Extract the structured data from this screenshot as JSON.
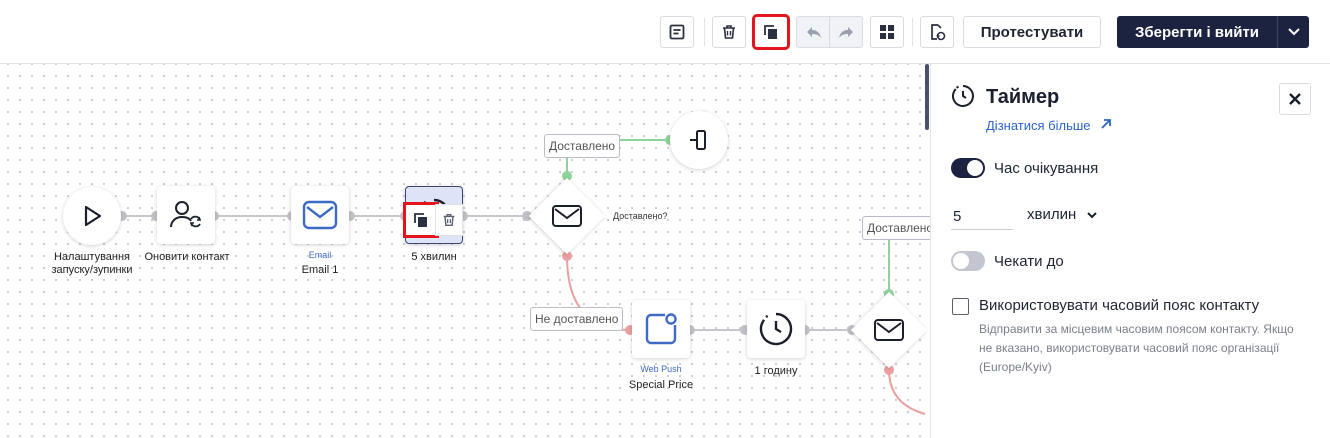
{
  "toolbar": {
    "notes_icon": "notes-icon",
    "delete_icon": "trash-icon",
    "copy_icon": "copy-icon",
    "undo_icon": "undo-icon",
    "redo_icon": "redo-icon",
    "layout_icon": "grid-icon",
    "history_icon": "document-restore-icon",
    "test_label": "Протестувати",
    "save_label": "Зберегти і вийти"
  },
  "canvas": {
    "nodes": {
      "start": {
        "caption_line1": "Налаштування",
        "caption_line2": "запуску/зупинки"
      },
      "update_contact": {
        "caption": "Оновити контакт"
      },
      "email": {
        "channel": "Email",
        "name": "Email 1"
      },
      "timer1": {
        "caption": "5 хвилин"
      },
      "check1": {
        "label": "Доставлено?"
      },
      "webpush": {
        "channel": "Web Push",
        "name": "Special Price"
      },
      "timer2": {
        "caption": "1 годину"
      }
    },
    "branches": {
      "delivered_1": "Доставлено",
      "not_delivered": "Не доставлено",
      "delivered_2": "Доставлено"
    }
  },
  "panel": {
    "title": "Таймер",
    "learn_more": "Дізнатися більше",
    "wait_time_label": "Час очікування",
    "wait_time_enabled": true,
    "wait_value": "5",
    "wait_unit": "хвилин",
    "wait_until_label": "Чекати до",
    "wait_until_enabled": false,
    "timezone_label": "Використовувати часовий пояс контакту",
    "timezone_help": "Відправити за місцевим часовим поясом контакту. Якщо не вказано, використовувати часовий пояс організації (Europe/Kyiv)",
    "timezone_checked": false
  },
  "colors": {
    "primary": "#1c2340",
    "accent_link": "#2b64c6",
    "success_line": "#8fd29a",
    "error_line": "#eaa0a0",
    "highlight": "#e3141b"
  }
}
